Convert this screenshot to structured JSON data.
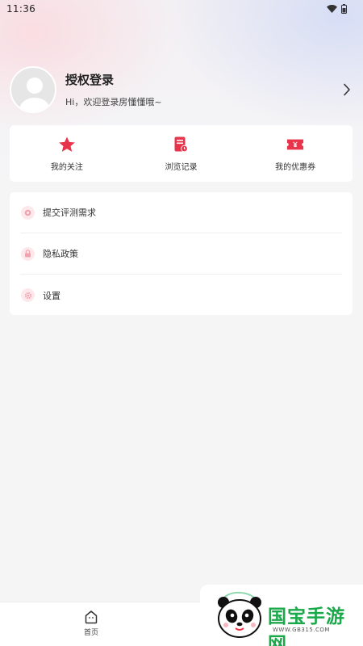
{
  "status_bar": {
    "time": "11:36"
  },
  "profile": {
    "title": "授权登录",
    "welcome": "Hi，欢迎登录房懂懂哦~"
  },
  "quick_actions": [
    {
      "label": "我的关注",
      "icon": "star-icon"
    },
    {
      "label": "浏览记录",
      "icon": "history-icon"
    },
    {
      "label": "我的优惠券",
      "icon": "coupon-icon"
    }
  ],
  "menu": [
    {
      "label": "提交评测需求",
      "icon": "submit-request-icon"
    },
    {
      "label": "隐私政策",
      "icon": "lock-icon"
    },
    {
      "label": "设置",
      "icon": "gear-icon"
    }
  ],
  "tab_bar": {
    "home_label": "首页"
  },
  "watermark": {
    "brand": "国宝手游网",
    "url": "WWW.GB315.COM"
  },
  "colors": {
    "accent": "#e8344a",
    "background": "#f5f5f6",
    "watermark_green": "#1aa84a"
  }
}
